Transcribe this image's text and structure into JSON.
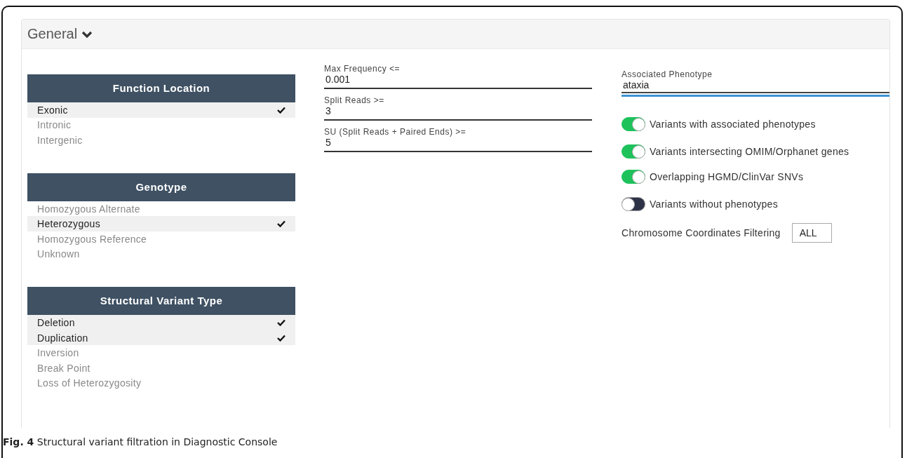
{
  "panel": {
    "title": "General",
    "expanded": true
  },
  "filter_groups": [
    {
      "title": "Function Location",
      "items": [
        {
          "label": "Exonic",
          "selected": true
        },
        {
          "label": "Intronic",
          "selected": false
        },
        {
          "label": "Intergenic",
          "selected": false
        }
      ]
    },
    {
      "title": "Genotype",
      "items": [
        {
          "label": "Homozygous Alternate",
          "selected": false
        },
        {
          "label": "Heterozygous",
          "selected": true
        },
        {
          "label": "Homozygous Reference",
          "selected": false
        },
        {
          "label": "Unknown",
          "selected": false
        }
      ]
    },
    {
      "title": "Structural Variant Type",
      "items": [
        {
          "label": "Deletion",
          "selected": true
        },
        {
          "label": "Duplication",
          "selected": true
        },
        {
          "label": "Inversion",
          "selected": false
        },
        {
          "label": "Break Point",
          "selected": false
        },
        {
          "label": "Loss of Heterozygosity",
          "selected": false
        }
      ]
    }
  ],
  "thresholds": [
    {
      "label": "Max Frequency <=",
      "value": "0.001"
    },
    {
      "label": "Split Reads >=",
      "value": "3"
    },
    {
      "label": "SU (Split Reads + Paired Ends) >=",
      "value": "5"
    }
  ],
  "phenotype_field": {
    "label": "Associated Phenotype",
    "value": "ataxia",
    "focused": true
  },
  "toggles": [
    {
      "label": "Variants with associated phenotypes",
      "on": true
    },
    {
      "label": "Variants intersecting OMIM/Orphanet genes",
      "on": true
    },
    {
      "label": "Overlapping HGMD/ClinVar SNVs",
      "on": true
    },
    {
      "label": "Variants without phenotypes",
      "on": false
    }
  ],
  "chromosome_filter": {
    "label": "Chromosome Coordinates Filtering",
    "value": "ALL"
  },
  "caption": "**Fig. 4** Structural variant filtration in Diagnostic Console"
}
